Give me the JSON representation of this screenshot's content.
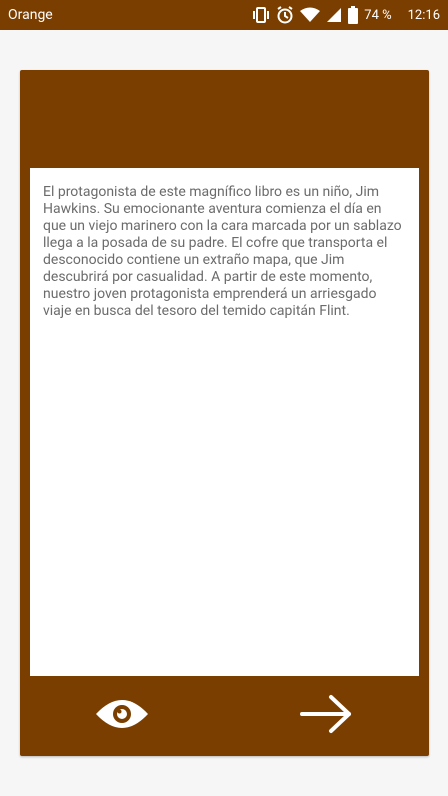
{
  "status_bar": {
    "carrier": "Orange",
    "battery": "74 %",
    "time": "12:16",
    "icons": [
      "vibrate-icon",
      "alarm-icon",
      "wifi-icon",
      "signal-icon",
      "battery-icon"
    ]
  },
  "card": {
    "description": "El protagonista de este magnífico libro es un niño, Jim Hawkins. Su emocionante aventura comienza el día en que un viejo marinero con la cara marcada por un sablazo llega a la posada de su padre. El cofre que transporta el desconocido contiene un extraño mapa, que Jim descubrirá por casualidad. A partir de este momento, nuestro joven protagonista emprenderá un arriesgado viaje en busca del tesoro del temido capitán Flint."
  },
  "footer": {
    "left_icon": "eye-icon",
    "right_icon": "arrow-right-icon"
  },
  "colors": {
    "brand": "#7a3e00",
    "text": "#6b6b6b",
    "background": "#f6f6f6"
  }
}
